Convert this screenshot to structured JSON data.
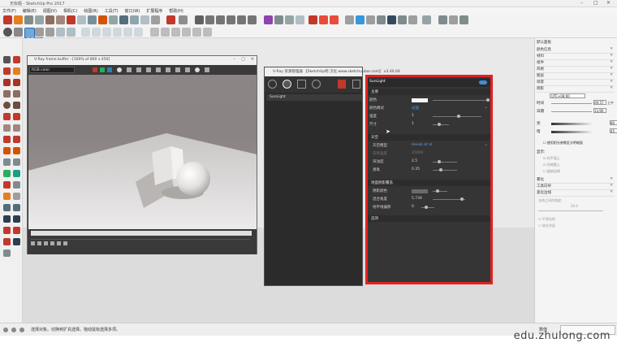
{
  "window": {
    "title": "无标题 - SketchUp Pro 2017"
  },
  "menu": [
    "文件(F)",
    "编辑(E)",
    "视图(V)",
    "相机(C)",
    "绘图(R)",
    "工具(T)",
    "窗口(W)",
    "扩展程序",
    "帮助(H)"
  ],
  "tooltip": "隐藏 (H)",
  "framebuffer": {
    "title": "V-Ray frame buffer - [100% of 800 x 450]",
    "channel": "RGB color"
  },
  "asset_editor": {
    "title": "V-Ray 资源管理器 【SketchUp吧 汉化 www.sketchupbar.com】 v3.40.04",
    "list_item": "SunLight"
  },
  "settings": {
    "header": "SunLight",
    "sections": {
      "main": "主要",
      "sky": "天空",
      "shadow": "地面阴影覆盖",
      "options": "选项"
    },
    "rows": {
      "color_label": "颜色",
      "color_mode_label": "颜色模式",
      "color_mode_value": "过滤",
      "intensity_label": "强度",
      "intensity_value": "1",
      "size_label": "尺寸",
      "size_value": "1",
      "sky_model_label": "天空模型",
      "sky_model_value": "Hosek et al",
      "illuminance_label": "日照强度",
      "illuminance_value": "25000",
      "turbidity_label": "浑浊度",
      "turbidity_value": "2.5",
      "ozone_label": "臭氧",
      "ozone_value": "0.35",
      "ground_color_label": "阴影颜色",
      "horizon_label": "混合角度",
      "horizon_value": "5.739",
      "offset_label": "地平线偏移",
      "offset_value": "0"
    }
  },
  "tray": {
    "title": "默认面板",
    "items": [
      "颜色信息",
      "材料",
      "组件",
      "风格",
      "图层",
      "场景",
      "阴影"
    ],
    "shadow": {
      "tz": "UTC+08:00",
      "time_label": "时间",
      "time_value": "09:57",
      "time_extra": "上午",
      "date_label": "日期",
      "date_value": "11/06",
      "light_label": "亮",
      "light_value": "80",
      "dark_label": "暗",
      "dark_value": "45",
      "sun_check": "使用阳光参数区分明暗面",
      "display_label": "显示:",
      "face_check": "在平面上",
      "ground_check": "在地面上",
      "edge_check": "起始边线"
    },
    "bottom_items": [
      "雾化",
      "工具向导",
      "柔化边线"
    ],
    "soften": {
      "normal_label": "法线之间的角度:",
      "normal_value": "20.0",
      "smooth_check": "平滑法线",
      "coplanar_check": "软化共面"
    }
  },
  "status": {
    "text": "选择对象。切换到扩充选择。拖动鼠标选择多项。",
    "measure_label": "数值"
  },
  "watermark": "edu.zhulong.com"
}
